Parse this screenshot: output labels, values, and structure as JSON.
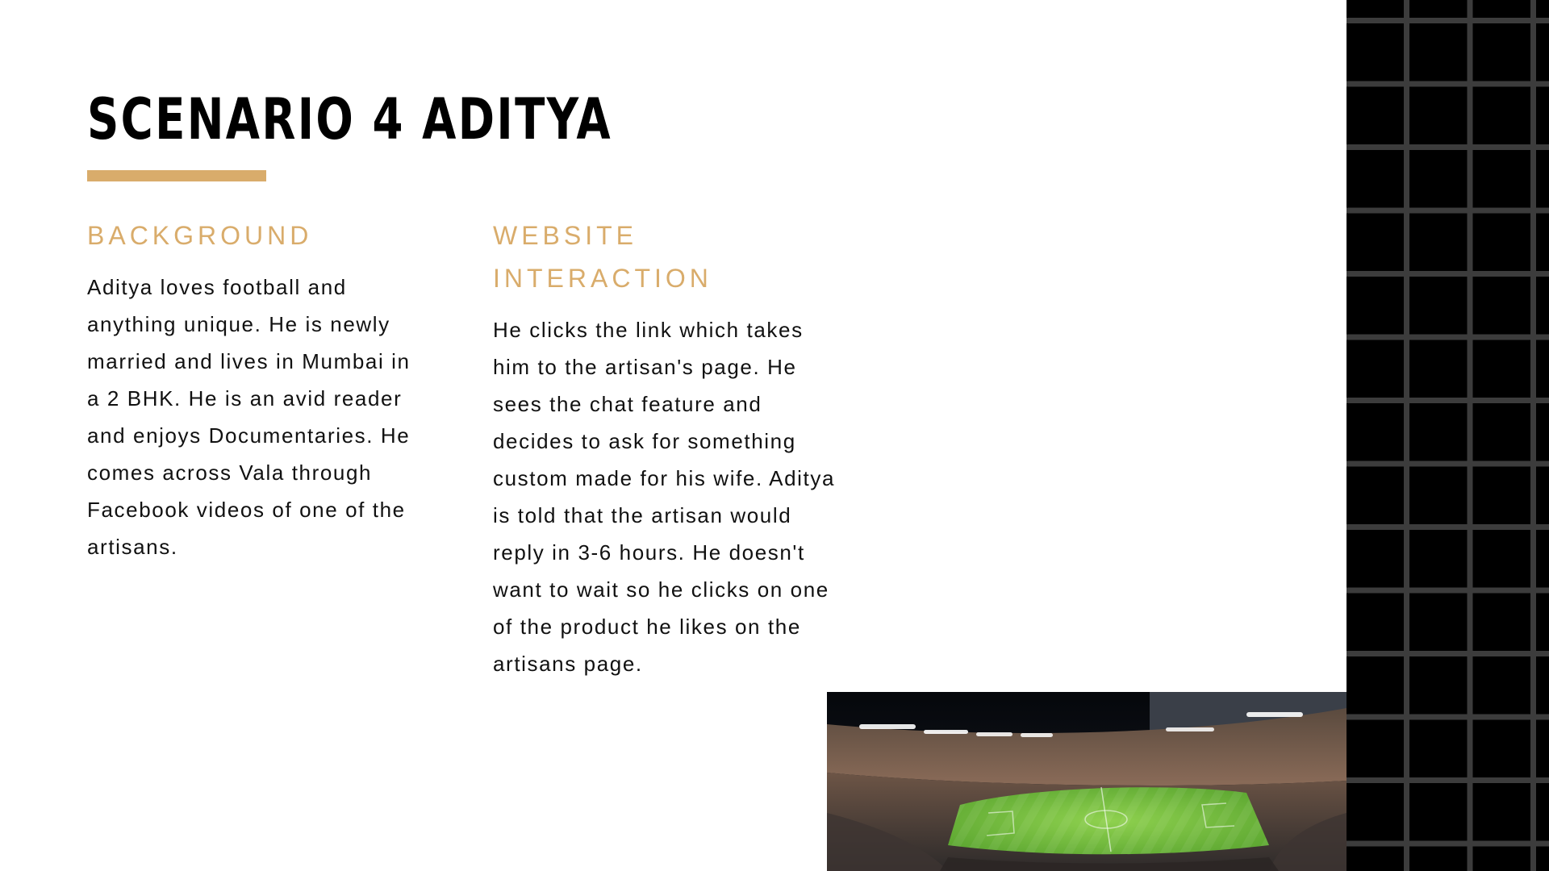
{
  "slide": {
    "title": "SCENARIO 4 ADITYA",
    "accent_color": "#d9ac6b",
    "background": {
      "heading": "BACKGROUND",
      "text": "Aditya loves football and anything unique. He is newly married and lives in Mumbai in a 2 BHK. He is an avid reader and enjoys Documentaries. He comes across Vala through Facebook videos of one of the artisans."
    },
    "website_interaction": {
      "heading_line1": "WEBSITE",
      "heading_line2": "INTERACTION",
      "text": "He clicks the link which takes him to the artisan's page. He sees the chat feature and decides to ask for something custom made for his wife. Aditya is told that the artisan would reply in 3-6 hours. He doesn't want to wait so he clicks on one of the product he likes on the artisans page."
    },
    "image": {
      "subject": "football-stadium-photo"
    },
    "decoration": {
      "grid_panel": "black-grid-pattern",
      "grid_line_color": "#3c3c3c"
    }
  }
}
